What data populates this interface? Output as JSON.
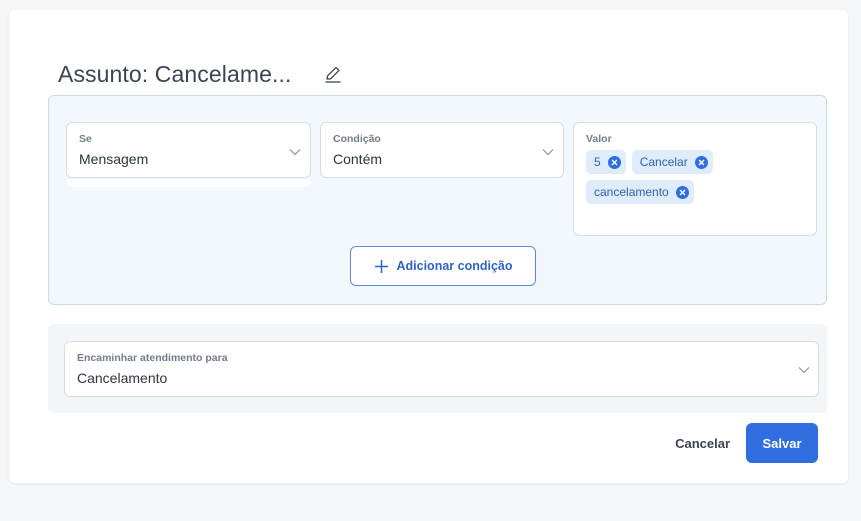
{
  "header": {
    "title": "Assunto: Cancelame..."
  },
  "rule": {
    "if_field": {
      "label": "Se",
      "value": "Mensagem"
    },
    "condition_field": {
      "label": "Condição",
      "value": "Contém"
    },
    "value_field": {
      "label": "Valor",
      "chips": [
        "5",
        "Cancelar",
        "cancelamento"
      ]
    },
    "add_condition_label": "Adicionar condição"
  },
  "forward": {
    "label": "Encaminhar atendimento para",
    "value": "Cancelamento"
  },
  "actions": {
    "cancel_label": "Cancelar",
    "save_label": "Salvar"
  },
  "colors": {
    "primary": "#2f6de0",
    "chip_bg": "#deecfb",
    "rule_bg": "#f2f8fd"
  },
  "icons": {
    "edit": "pencil-icon",
    "dropdown": "chevron-down-icon",
    "chip_remove": "close-circle-icon",
    "add": "plus-icon"
  }
}
